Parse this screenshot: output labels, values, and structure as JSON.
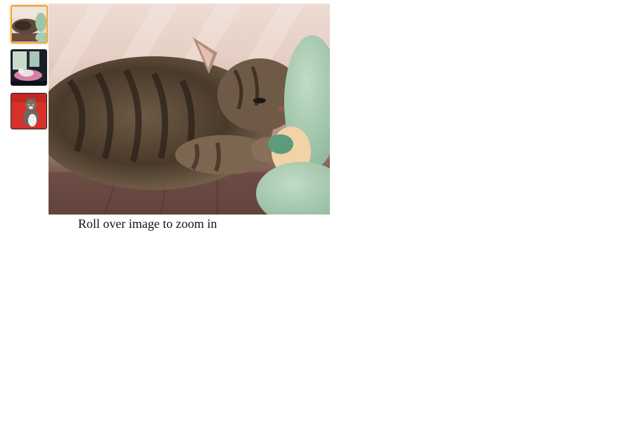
{
  "gallery": {
    "zoom_hint": "Roll over image to zoom in",
    "selected_index": 0,
    "thumbnails": [
      {
        "subject": "cat-lying-with-plush-toy"
      },
      {
        "subject": "cat-on-pink-blanket-by-window"
      },
      {
        "subject": "cat-sitting-on-red-background"
      }
    ]
  },
  "colors": {
    "selected_border": "#f0a838",
    "thumb_border": "#222222"
  }
}
